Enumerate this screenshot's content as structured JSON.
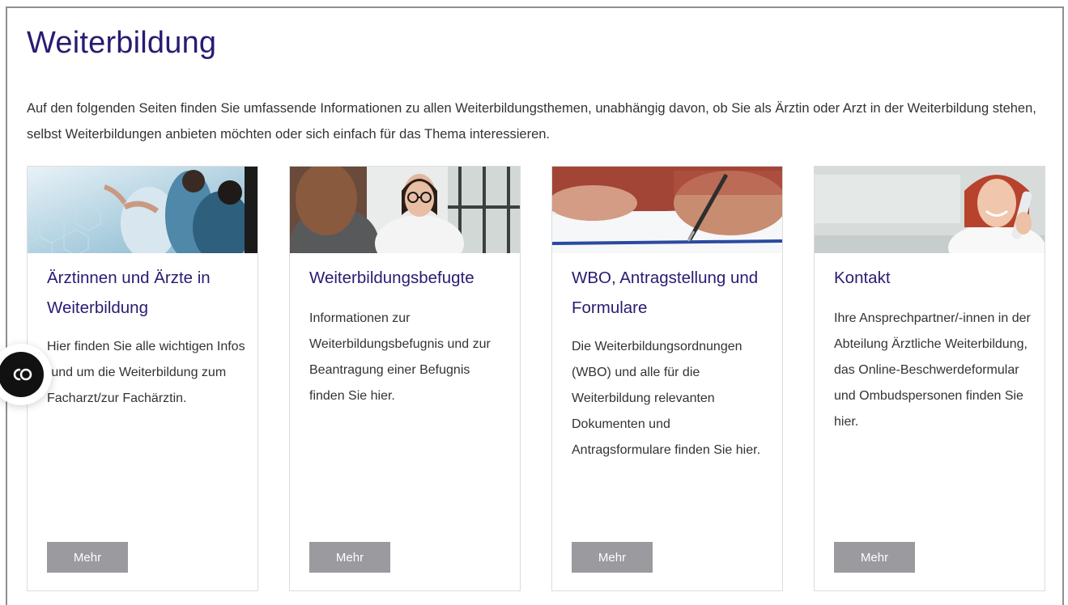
{
  "page": {
    "title": "Weiterbildung",
    "intro": "Auf den folgenden Seiten finden Sie umfassende Informationen zu allen Weiterbildungsthemen, unabhängig davon, ob Sie als Ärztin oder Arzt in der Weiterbildung stehen, selbst Weiterbildungen anbieten möchten oder sich einfach für das Thema interessieren."
  },
  "cards": [
    {
      "title": "Ärztinnen und Ärzte in Weiterbildung",
      "text": "Hier finden Sie alle wichtigen Infos rund um die Weiterbildung zum Facharzt/zur Fachärztin.",
      "button": "Mehr",
      "image": "doctors-team-photo"
    },
    {
      "title": "Weiterbildungsbefugte",
      "text": "Informationen zur Weiterbildungsbefugnis und zur Beantragung einer Befugnis finden Sie hier.",
      "button": "Mehr",
      "image": "doctor-consultation-photo"
    },
    {
      "title": "WBO, Antragstellung und Formulare",
      "text": "Die Weiterbildungsordnungen (WBO) und alle für die Weiterbildung relevanten Dokumenten und Antragsformulare finden Sie hier.",
      "button": "Mehr",
      "image": "signing-document-photo"
    },
    {
      "title": "Kontakt",
      "text": "Ihre Ansprechpartner/-innen in der Abteilung Ärztliche Weiterbildung, das Online-Beschwerdeformular und Ombudspersonen finden Sie hier.",
      "button": "Mehr",
      "image": "woman-on-phone-photo"
    }
  ],
  "side_widget": {
    "icon": "accessibility-widget-icon"
  },
  "colors": {
    "heading": "#2b1a72",
    "text": "#333333",
    "button": "#9a9a9f",
    "border": "#dcdcdc"
  }
}
